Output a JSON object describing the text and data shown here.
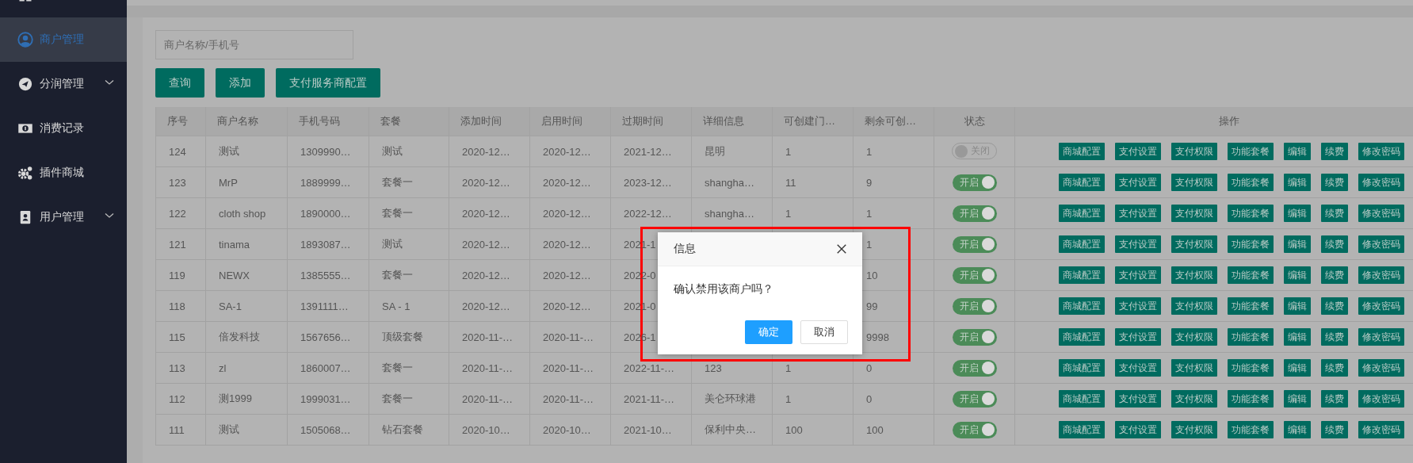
{
  "sidebar": {
    "items": [
      {
        "selected": false
      },
      {
        "label": "商户管理",
        "selected": true,
        "expandable": false
      },
      {
        "label": "分润管理",
        "selected": false,
        "expandable": true
      },
      {
        "label": "消费记录",
        "selected": false,
        "expandable": false
      },
      {
        "label": "插件商城",
        "selected": false,
        "expandable": false
      },
      {
        "label": "用户管理",
        "selected": false,
        "expandable": true
      }
    ]
  },
  "search": {
    "placeholder": "商户名称/手机号"
  },
  "buttons": [
    "查询",
    "添加",
    "支付服务商配置"
  ],
  "table": {
    "columns": [
      "序号",
      "商户名称",
      "手机号码",
      "套餐",
      "添加时间",
      "启用时间",
      "过期时间",
      "详细信息",
      "可创建门…",
      "剩余可创…",
      "状态",
      "操作"
    ],
    "rows": [
      {
        "cells": [
          "124",
          "测试",
          "1309990…",
          "测试",
          "2020-12…",
          "2020-12…",
          "2021-12…",
          "昆明",
          "1",
          "1"
        ],
        "status": {
          "on": false,
          "label": "关闭"
        },
        "actions": [
          "商城配置",
          "支付设置",
          "支付权限",
          "功能套餐",
          "编辑",
          "续费",
          "修改密码"
        ]
      },
      {
        "cells": [
          "123",
          "MrP",
          "1889999…",
          "套餐一",
          "2020-12…",
          "2020-12…",
          "2023-12…",
          "shangha…",
          "11",
          "9"
        ],
        "status": {
          "on": true,
          "label": "开启"
        },
        "actions": [
          "商城配置",
          "支付设置",
          "支付权限",
          "功能套餐",
          "编辑",
          "续费",
          "修改密码"
        ]
      },
      {
        "cells": [
          "122",
          "cloth shop",
          "1890000…",
          "套餐一",
          "2020-12…",
          "2020-12…",
          "2022-12…",
          "shangha…",
          "1",
          "1"
        ],
        "status": {
          "on": true,
          "label": "开启"
        },
        "actions": [
          "商城配置",
          "支付设置",
          "支付权限",
          "功能套餐",
          "编辑",
          "续费",
          "修改密码"
        ]
      },
      {
        "cells": [
          "121",
          "tinama",
          "1893087…",
          "测试",
          "2020-12…",
          "2020-12…",
          "2021-1",
          null,
          null,
          "1"
        ],
        "status": {
          "on": true,
          "label": "开启"
        },
        "actions": [
          "商城配置",
          "支付设置",
          "支付权限",
          "功能套餐",
          "编辑",
          "续费",
          "修改密码"
        ]
      },
      {
        "cells": [
          "119",
          "NEWX",
          "1385555…",
          "套餐一",
          "2020-12…",
          "2020-12…",
          "2022-0",
          null,
          null,
          "10"
        ],
        "status": {
          "on": true,
          "label": "开启"
        },
        "actions": [
          "商城配置",
          "支付设置",
          "支付权限",
          "功能套餐",
          "编辑",
          "续费",
          "修改密码"
        ]
      },
      {
        "cells": [
          "118",
          "SA-1",
          "1391111…",
          "SA - 1",
          "2020-12…",
          "2020-12…",
          "2021-0",
          null,
          null,
          "99"
        ],
        "status": {
          "on": true,
          "label": "开启"
        },
        "actions": [
          "商城配置",
          "支付设置",
          "支付权限",
          "功能套餐",
          "编辑",
          "续费",
          "修改密码"
        ]
      },
      {
        "cells": [
          "115",
          "倍发科技",
          "1567656…",
          "顶级套餐",
          "2020-11-…",
          "2020-11-…",
          "2026-1",
          null,
          null,
          "9998"
        ],
        "status": {
          "on": true,
          "label": "开启"
        },
        "actions": [
          "商城配置",
          "支付设置",
          "支付权限",
          "功能套餐",
          "编辑",
          "续费",
          "修改密码"
        ]
      },
      {
        "cells": [
          "113",
          "zl",
          "1860007…",
          "套餐一",
          "2020-11-…",
          "2020-11-…",
          "2022-11-…",
          "123",
          "1",
          "0"
        ],
        "status": {
          "on": true,
          "label": "开启"
        },
        "actions": [
          "商城配置",
          "支付设置",
          "支付权限",
          "功能套餐",
          "编辑",
          "续费",
          "修改密码"
        ]
      },
      {
        "cells": [
          "112",
          "测1999",
          "1999031…",
          "套餐一",
          "2020-11-…",
          "2020-11-…",
          "2021-11-…",
          "美仑环球港",
          "1",
          "0"
        ],
        "status": {
          "on": true,
          "label": "开启"
        },
        "actions": [
          "商城配置",
          "支付设置",
          "支付权限",
          "功能套餐",
          "编辑",
          "续费",
          "修改密码"
        ]
      },
      {
        "cells": [
          "111",
          "测试",
          "1505068…",
          "钻石套餐",
          "2020-10…",
          "2020-10…",
          "2021-10…",
          "保利中央…",
          "100",
          "100"
        ],
        "status": {
          "on": true,
          "label": "开启"
        },
        "actions": [
          "商城配置",
          "支付设置",
          "支付权限",
          "功能套餐",
          "编辑",
          "续费",
          "修改密码"
        ]
      }
    ]
  },
  "dialog": {
    "title": "信息",
    "message": "确认禁用该商户吗？",
    "buttons": [
      {
        "label": "确定",
        "kind": "primary"
      },
      {
        "label": "取消",
        "kind": "secondary"
      }
    ]
  }
}
